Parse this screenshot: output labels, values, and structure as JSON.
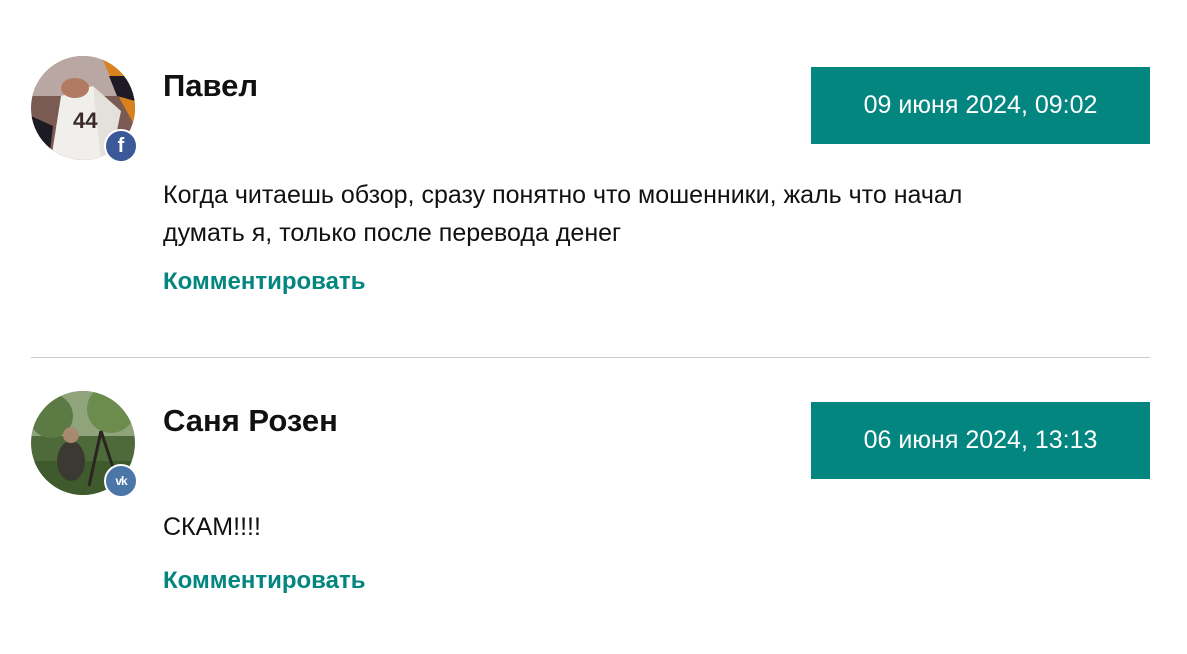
{
  "comments": [
    {
      "author": "Павел",
      "date": "09 июня 2024, 09:02",
      "text": "Когда читаешь обзор, сразу понятно что мошенники, жаль что начал думать я, только после перевода денег",
      "reply_label": "Комментировать",
      "social_badge": "f",
      "social_icon": "facebook-icon",
      "social_color": "#3b5998"
    },
    {
      "author": "Саня Розен",
      "date": "06 июня 2024, 13:13",
      "text": "СКАМ!!!!",
      "reply_label": "Комментировать",
      "social_badge": "vk",
      "social_icon": "vk-icon",
      "social_color": "#4a76a8"
    }
  ],
  "colors": {
    "accent": "#038580",
    "divider": "#cccccc",
    "text": "#111111"
  }
}
